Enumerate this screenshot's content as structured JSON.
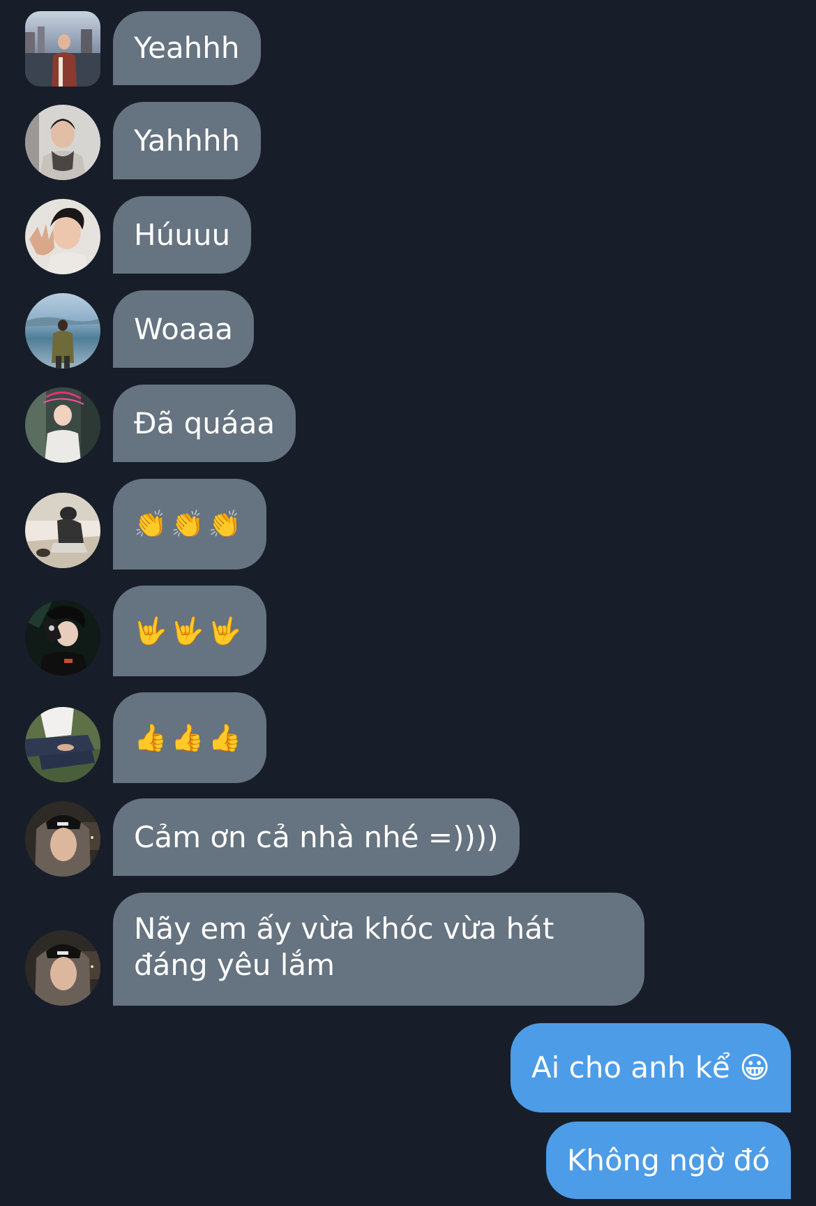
{
  "conversation": {
    "incoming": [
      {
        "sender_avatar": "avatar-city-photo",
        "text": "Yeahhh"
      },
      {
        "sender_avatar": "avatar-person-scarf",
        "text": "Yahhhh"
      },
      {
        "sender_avatar": "avatar-person-hand",
        "text": "Húuuu"
      },
      {
        "sender_avatar": "avatar-person-beach",
        "text": "Woaaa"
      },
      {
        "sender_avatar": "avatar-person-sweater",
        "text": "Đã quáaa"
      },
      {
        "sender_avatar": "avatar-person-crouching",
        "text": "👏👏👏"
      },
      {
        "sender_avatar": "avatar-person-phone",
        "text": "🤟🤟🤟"
      },
      {
        "sender_avatar": "avatar-person-sitting",
        "text": "👍👍👍"
      },
      {
        "sender_avatar": "avatar-person-hood",
        "text": "Cảm ơn cả nhà nhé =))))"
      },
      {
        "sender_avatar": "avatar-person-hood",
        "text": "Nãy em ấy vừa khóc vừa hát đáng yêu lắm"
      }
    ],
    "outgoing": [
      {
        "text": "Ai cho anh kể 😀"
      },
      {
        "text": "Không ngờ đó"
      }
    ]
  },
  "colors": {
    "background": "#171e29",
    "incoming_bubble": "#667380",
    "outgoing_bubble": "#4d9ce8",
    "text": "#ffffff"
  }
}
